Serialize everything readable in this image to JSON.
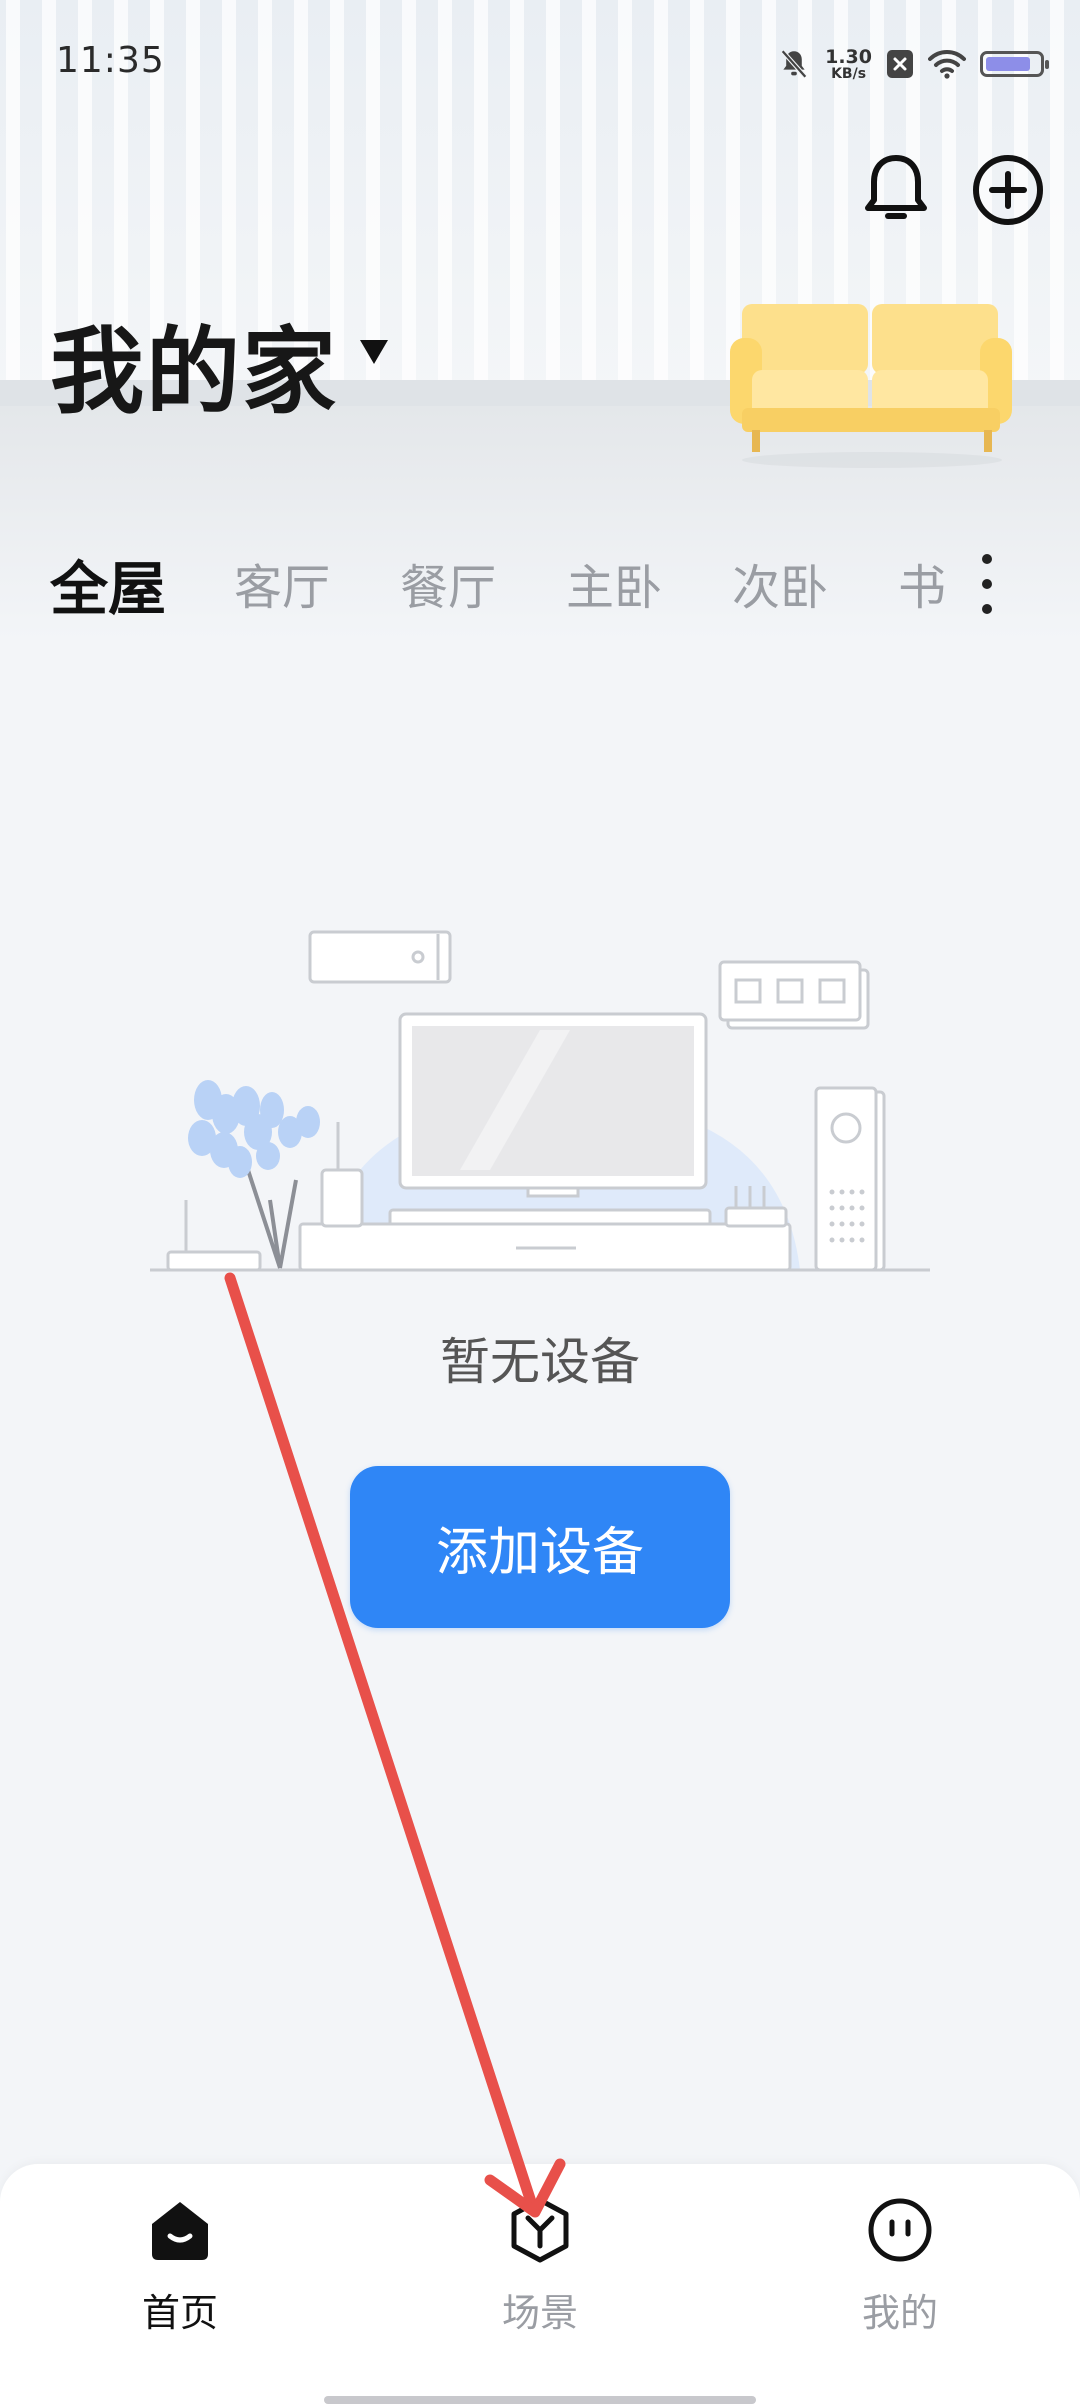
{
  "status_bar": {
    "time": "11:35",
    "net_speed_value": "1.30",
    "net_speed_unit": "KB/s",
    "battery_level": 0.85,
    "icons": [
      "bell-muted-icon",
      "netspeed",
      "sim-x-icon",
      "wifi-icon",
      "battery-icon"
    ]
  },
  "header": {
    "title": "我的家",
    "actions": [
      "bell-icon",
      "add-circle-icon"
    ]
  },
  "room_tabs": [
    {
      "label": "全屋",
      "active": true
    },
    {
      "label": "客厅",
      "active": false
    },
    {
      "label": "餐厅",
      "active": false
    },
    {
      "label": "主卧",
      "active": false
    },
    {
      "label": "次卧",
      "active": false
    },
    {
      "label": "书",
      "active": false
    }
  ],
  "empty_state": {
    "message": "暂无设备",
    "button_label": "添加设备"
  },
  "bottom_nav": {
    "items": [
      {
        "label": "首页",
        "icon": "home-icon",
        "active": true
      },
      {
        "label": "场景",
        "icon": "scene-cube-icon",
        "active": false
      },
      {
        "label": "我的",
        "icon": "smiley-face-icon",
        "active": false
      }
    ]
  },
  "colors": {
    "accent": "#2f86f6",
    "annotation_arrow": "#e8504a",
    "text_primary": "#111111",
    "text_muted": "#9a9da3"
  }
}
